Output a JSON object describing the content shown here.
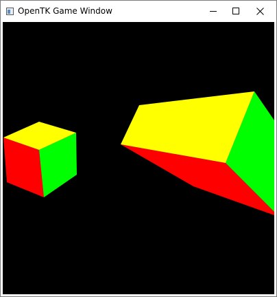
{
  "window": {
    "title": "OpenTK Game Window",
    "icon": "opentk-app-icon",
    "controls": {
      "minimize": "minimize-icon",
      "maximize": "maximize-icon",
      "close": "close-icon"
    }
  },
  "scene": {
    "background_color": "#000000",
    "face_colors": {
      "top": "#ffff00",
      "left": "#ff0000",
      "right": "#00ff00"
    },
    "objects": [
      {
        "name": "small-cube",
        "type": "cube"
      },
      {
        "name": "large-box",
        "type": "box"
      }
    ]
  }
}
